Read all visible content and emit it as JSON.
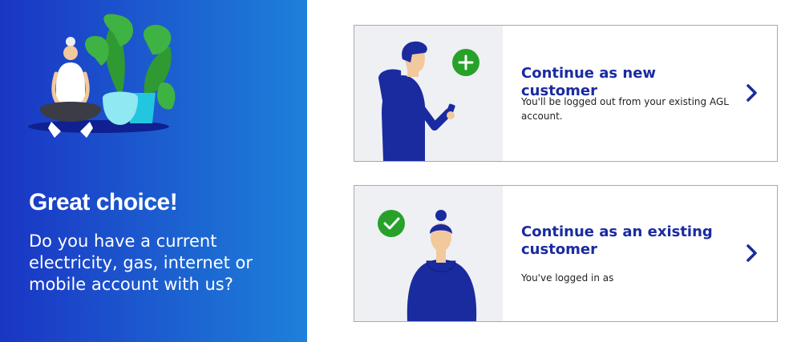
{
  "panel": {
    "title": "Great choice!",
    "question": "Do you have a current electricity, gas, internet or mobile account with us?",
    "illustration_icon": "meditating-person-with-plants-illustration"
  },
  "cards": {
    "new_customer": {
      "title": "Continue as new customer",
      "description": "You'll be logged out from your existing AGL account.",
      "badge_icon": "plus-icon",
      "chevron_icon": "chevron-right-icon"
    },
    "existing_customer": {
      "title": "Continue as an existing customer",
      "description": "You've logged in as",
      "badge_icon": "check-icon",
      "chevron_icon": "chevron-right-icon"
    }
  },
  "colors": {
    "panel_gradient_start": "#1a35c4",
    "panel_gradient_end": "#1e80da",
    "title_blue": "#1a2ba0",
    "badge_green": "#27a12a",
    "card_art_bg": "#eff0f4",
    "card_border": "#a9a9a9"
  }
}
